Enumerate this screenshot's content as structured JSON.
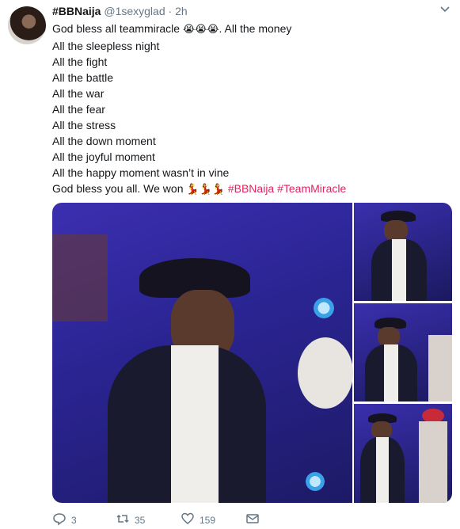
{
  "tweet": {
    "author_name": "#BBNaija",
    "handle": "@1sexyglad",
    "separator": "·",
    "time": "2h",
    "lines": [
      "All the sleepless night",
      "All the fight",
      "All the battle",
      "All the war",
      "All the fear",
      "All the stress",
      "All the down moment",
      "All the joyful moment",
      "All the happy moment wasn’t in vine"
    ],
    "first_line_start": "God bless all teammiracle ",
    "first_line_emoji": "😭😭😭",
    "first_line_end": ". All the money",
    "last_line_start": "God bless you all. We won ",
    "last_line_emoji": "💃💃💃",
    "hashtags": [
      "#BBNaija",
      "#TeamMiracle"
    ]
  },
  "actions": {
    "replies": "3",
    "retweets": "35",
    "likes": "159"
  },
  "icons": {
    "menu": "chevron-down-icon",
    "reply": "reply-icon",
    "retweet": "retweet-icon",
    "like": "heart-icon",
    "message": "envelope-icon"
  },
  "colors": {
    "hashtag": "#e0245e",
    "muted": "#657786",
    "text": "#14171a",
    "stage_blue": "#2b2595"
  }
}
